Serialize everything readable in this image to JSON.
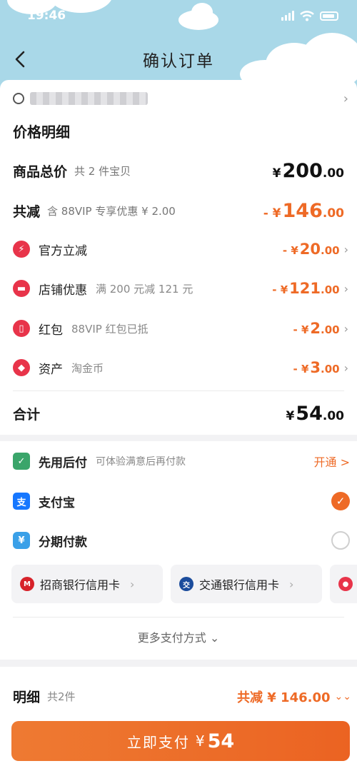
{
  "status": {
    "time": "19:46"
  },
  "nav": {
    "title": "确认订单"
  },
  "price": {
    "title": "价格明细",
    "total": {
      "label": "商品总价",
      "sub": "共 2 件宝贝",
      "currency": "¥",
      "int": "200",
      "dec": ".00"
    },
    "reduce": {
      "label": "共减",
      "sub": "含 88VIP 专享优惠 ¥ 2.00",
      "prefix": "- ¥",
      "int": "146",
      "dec": ".00"
    },
    "items": [
      {
        "label": "官方立减",
        "sub": "",
        "prefix": "- ¥",
        "int": "20",
        "dec": ".00",
        "icon": "lightning-icon",
        "glyph": "⚡",
        "color": "#e8344a"
      },
      {
        "label": "店铺优惠",
        "sub": "满 200 元减 121 元",
        "prefix": "- ¥",
        "int": "121",
        "dec": ".00",
        "icon": "store-coupon-icon",
        "glyph": "▬",
        "color": "#e8344a"
      },
      {
        "label": "红包",
        "sub": "88VIP 红包已抵",
        "prefix": "- ¥",
        "int": "2",
        "dec": ".00",
        "icon": "red-packet-icon",
        "glyph": "▯",
        "color": "#e8344a"
      },
      {
        "label": "资产",
        "sub": "淘金币",
        "prefix": "- ¥",
        "int": "3",
        "dec": ".00",
        "icon": "tag-icon",
        "glyph": "◆",
        "color": "#e8344a"
      }
    ],
    "sum": {
      "label": "合计",
      "currency": "¥",
      "int": "54",
      "dec": ".00"
    }
  },
  "payment": {
    "later": {
      "label": "先用后付",
      "sub": "可体验满意后再付款",
      "link": "开通 >",
      "icon": "pay-later-icon",
      "color": "#3aa56a"
    },
    "alipay": {
      "label": "支付宝",
      "icon": "alipay-icon",
      "color": "#1677ff",
      "selected": true
    },
    "installment": {
      "label": "分期付款",
      "icon": "installment-icon",
      "color": "#3aa0e8",
      "selected": false
    },
    "banks": [
      {
        "name": "招商银行信用卡",
        "icon": "cmb-logo-icon",
        "color": "#d7222a"
      },
      {
        "name": "交通银行信用卡",
        "icon": "bocom-logo-icon",
        "color": "#1b4c9c"
      }
    ],
    "more": "更多支付方式 ⌄"
  },
  "summary": {
    "label": "明细",
    "sub": "共2件",
    "total": "共减 ¥ 146.00",
    "button_label": "立即支付",
    "button_currency": "¥",
    "button_amount": "54"
  },
  "colors": {
    "accent": "#ee6a26",
    "sky": "#a9d8e8"
  }
}
